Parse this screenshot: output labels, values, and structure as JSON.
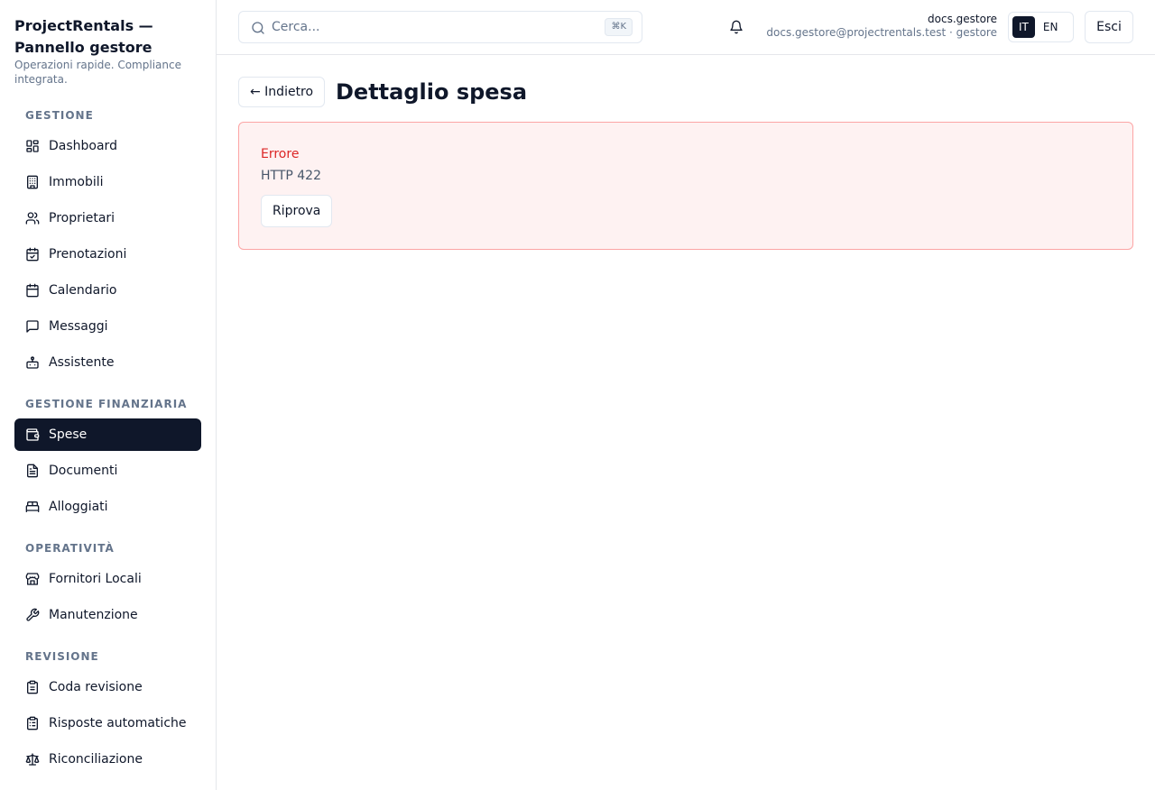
{
  "sidebar": {
    "brand_title": "ProjectRentals — Pannello gestore",
    "brand_subtitle": "Operazioni rapide. Compliance integrata.",
    "sections": [
      {
        "label": "GESTIONE",
        "items": [
          {
            "label": "Dashboard",
            "icon": "dashboard-icon"
          },
          {
            "label": "Immobili",
            "icon": "building-icon"
          },
          {
            "label": "Proprietari",
            "icon": "users-icon"
          },
          {
            "label": "Prenotazioni",
            "icon": "calendar-check-icon"
          },
          {
            "label": "Calendario",
            "icon": "calendar-icon"
          },
          {
            "label": "Messaggi",
            "icon": "message-icon"
          },
          {
            "label": "Assistente",
            "icon": "bot-icon"
          }
        ]
      },
      {
        "label": "GESTIONE FINANZIARIA",
        "items": [
          {
            "label": "Spese",
            "icon": "wallet-icon",
            "active": true
          },
          {
            "label": "Documenti",
            "icon": "document-icon"
          },
          {
            "label": "Alloggiati",
            "icon": "bed-icon"
          }
        ]
      },
      {
        "label": "OPERATIVITÀ",
        "items": [
          {
            "label": "Fornitori Locali",
            "icon": "store-icon"
          },
          {
            "label": "Manutenzione",
            "icon": "wrench-icon"
          }
        ]
      },
      {
        "label": "REVISIONE",
        "items": [
          {
            "label": "Coda revisione",
            "icon": "clipboard-icon"
          },
          {
            "label": "Risposte automatiche",
            "icon": "clipboard-list-icon"
          },
          {
            "label": "Riconciliazione",
            "icon": "scale-icon"
          }
        ]
      }
    ]
  },
  "topbar": {
    "search_placeholder": "Cerca...",
    "search_value": "",
    "search_shortcut": "⌘K",
    "user_name": "docs.gestore",
    "user_email_role": "docs.gestore@projectrentals.test · gestore",
    "lang_it": "IT",
    "lang_en": "EN",
    "active_lang": "IT",
    "logout_label": "Esci"
  },
  "main": {
    "back_label": "← Indietro",
    "title": "Dettaglio spesa",
    "error": {
      "title": "Errore",
      "message": "HTTP 422",
      "retry_label": "Riprova"
    }
  },
  "colors": {
    "accent": "#0f172a",
    "error_text": "#dc2626",
    "error_bg": "#fef2f2",
    "error_border": "#fca5a5",
    "muted": "#64748b"
  }
}
